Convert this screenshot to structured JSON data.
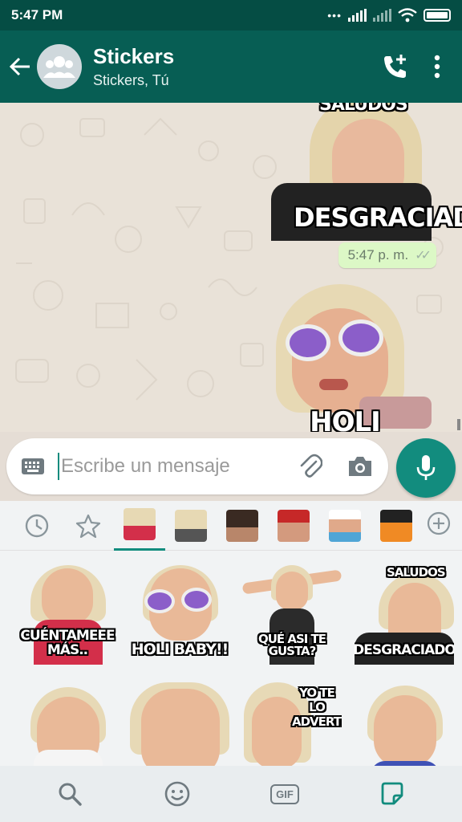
{
  "status_bar": {
    "time": "5:47 PM"
  },
  "header": {
    "title": "Stickers",
    "subtitle": "Stickers, Tú"
  },
  "messages": [
    {
      "type": "sticker",
      "caption_top": "SALUDOS",
      "caption_bottom": "DESGRACIADO"
    },
    {
      "type": "time",
      "text": "5:47 p. m."
    },
    {
      "type": "sticker",
      "caption_bottom": "HOLI BABY!!"
    }
  ],
  "compose": {
    "placeholder": "Escribe un mensaje"
  },
  "sticker_panel": {
    "pack_thumbs": [
      "pack-1",
      "pack-2",
      "pack-3",
      "pack-4",
      "pack-5",
      "pack-6"
    ],
    "stickers": [
      {
        "caption": "CUÉNTAMEEE MÁS..",
        "top": ""
      },
      {
        "caption": "HOLI BABY!!",
        "top": ""
      },
      {
        "caption": "QUÉ ASI TE GUSTA?",
        "top": ""
      },
      {
        "caption": "DESGRACIADO",
        "top": "SALUDOS"
      },
      {
        "caption": "",
        "top": ""
      },
      {
        "caption": "",
        "top": ""
      },
      {
        "caption": "",
        "top": "YO TE LO ADVERTI!!"
      },
      {
        "caption": "",
        "top": ""
      }
    ]
  },
  "colors": {
    "primary": "#075e54",
    "accent": "#128c7e",
    "bubble": "#dcf8c6"
  },
  "bottom_bar": {
    "gif_label": "GIF"
  }
}
